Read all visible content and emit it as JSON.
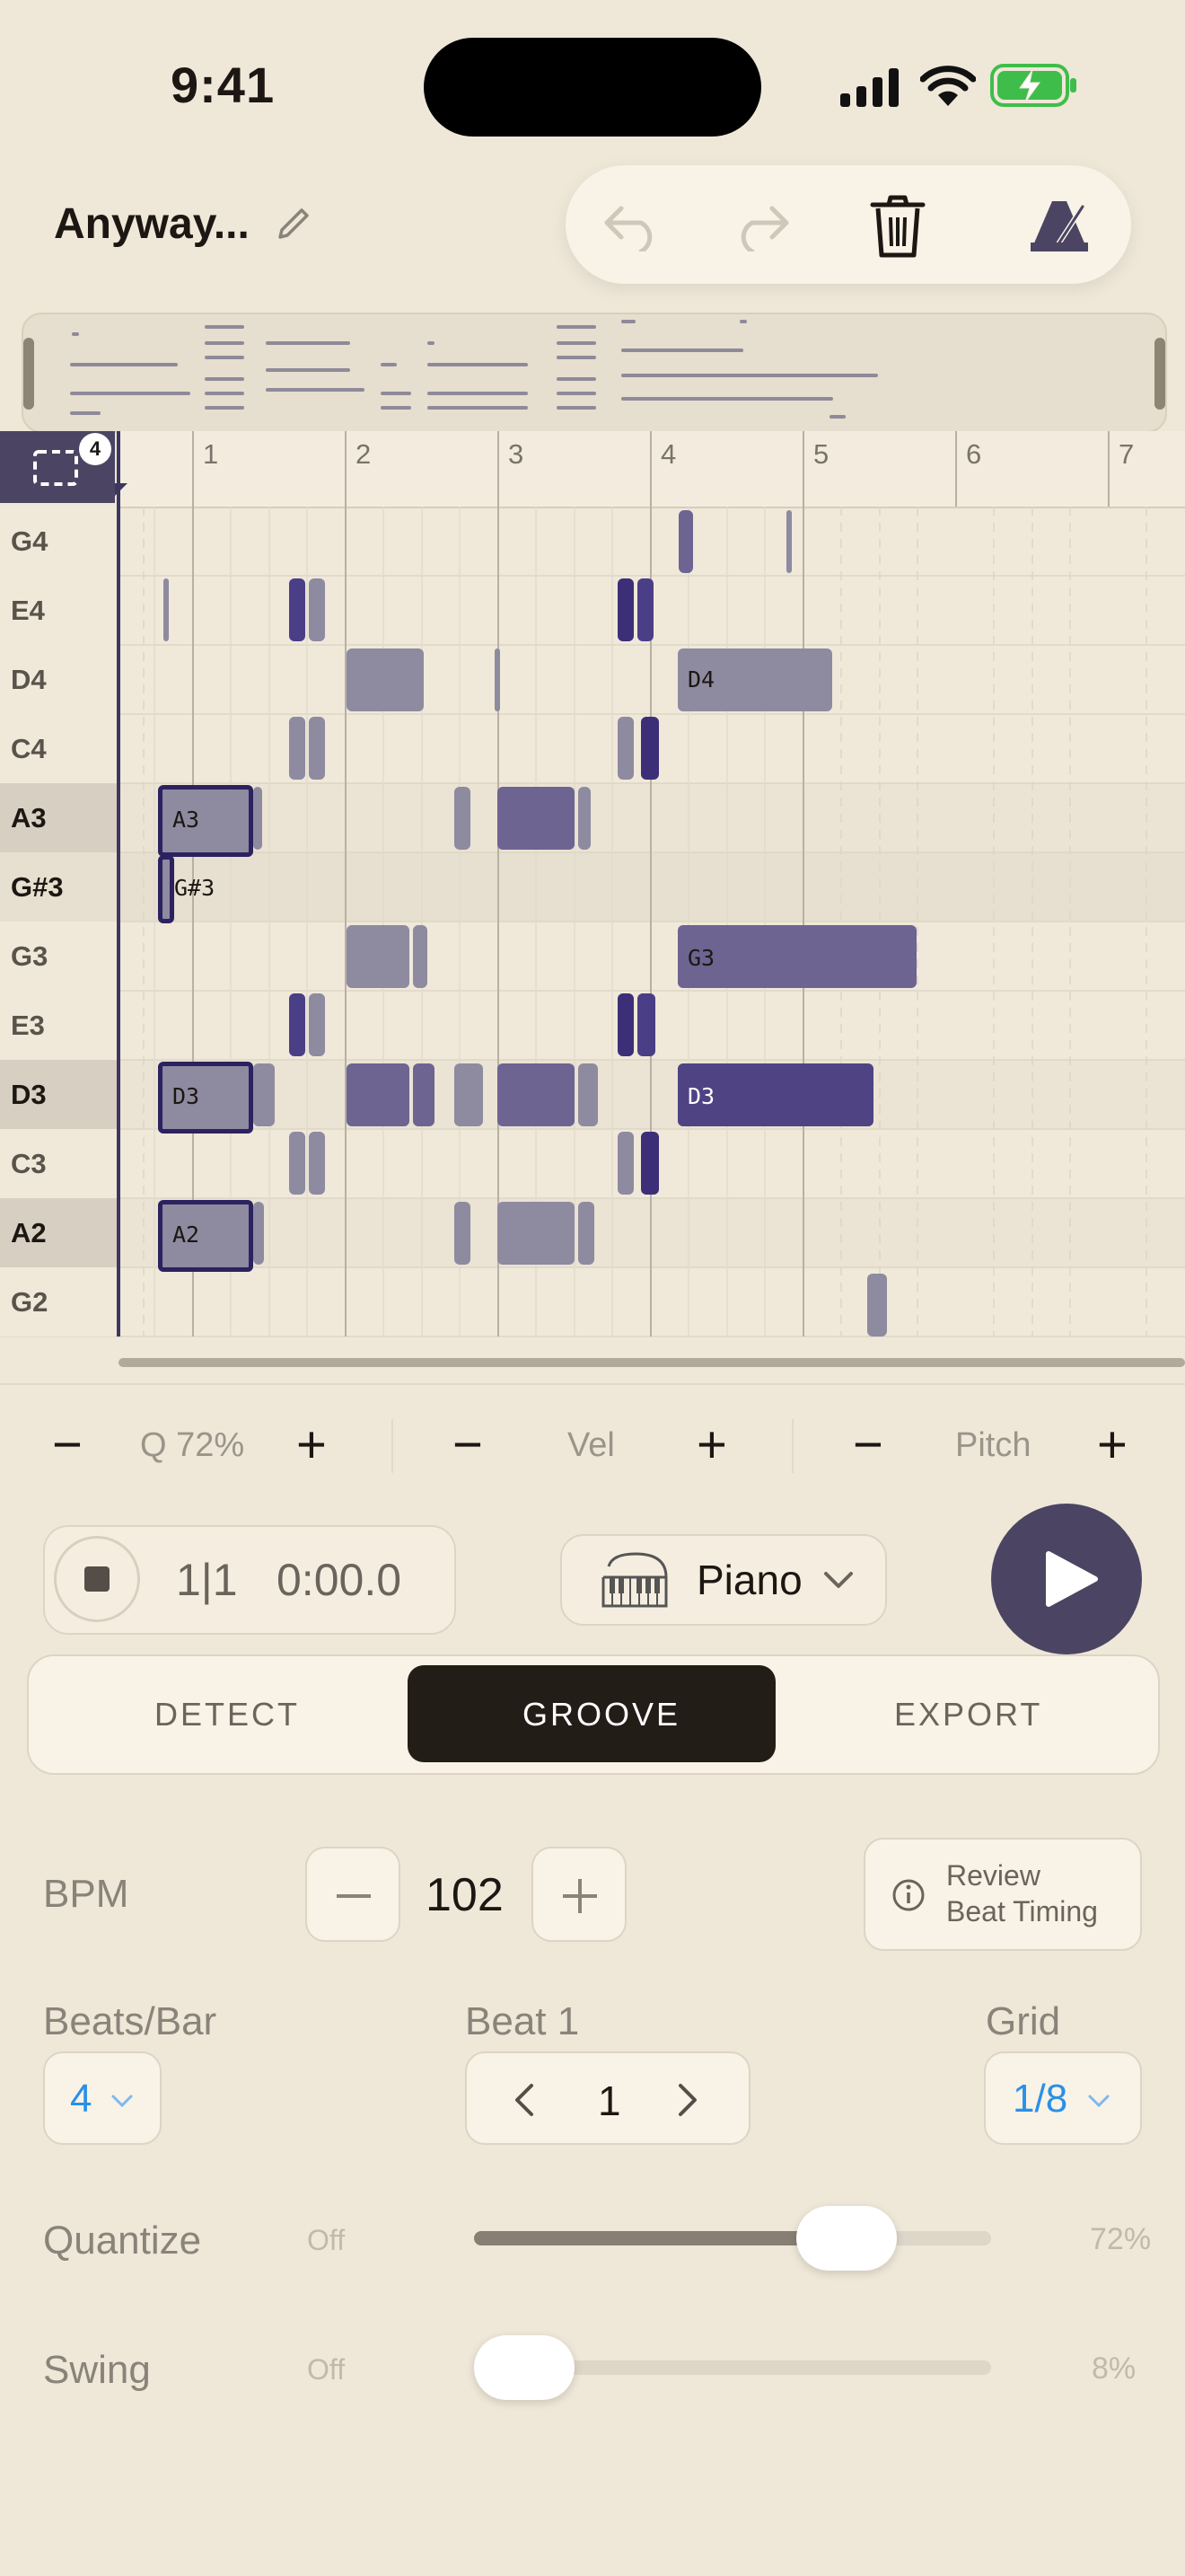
{
  "status_bar": {
    "time": "9:41"
  },
  "header": {
    "title": "Anyway..."
  },
  "toolbar": {
    "icons": [
      "undo-icon",
      "redo-icon",
      "trash-icon",
      "metronome-icon"
    ]
  },
  "piano_roll": {
    "selection_count": "4",
    "bars": [
      "1",
      "2",
      "3",
      "4",
      "5",
      "6",
      "7"
    ],
    "keys": [
      "G4",
      "E4",
      "D4",
      "C4",
      "A3",
      "G#3",
      "G3",
      "E3",
      "D3",
      "C3",
      "A2",
      "G2"
    ],
    "note_labels": {
      "a3": "A3",
      "gs3": "G#3",
      "d3": "D3",
      "a2": "A2",
      "d4": "D4",
      "g3": "G3",
      "d3_long": "D3"
    }
  },
  "nudge": {
    "minus": "−",
    "plus": "+",
    "quantize": "Q 72%",
    "velocity": "Vel",
    "pitch": "Pitch"
  },
  "transport": {
    "position": "1|1",
    "time": "0:00.0"
  },
  "instrument": {
    "name": "Piano"
  },
  "tabs": {
    "detect": "DETECT",
    "groove": "GROOVE",
    "export": "EXPORT",
    "active": "GROOVE"
  },
  "groove": {
    "bpm_label": "BPM",
    "bpm_value": "102",
    "review_line1": "Review",
    "review_line2": "Beat Timing",
    "beats_per_bar_label": "Beats/Bar",
    "beats_per_bar_value": "4",
    "beat1_label": "Beat 1",
    "beat1_value": "1",
    "grid_label": "Grid",
    "grid_value": "1/8",
    "quantize_label": "Quantize",
    "quantize_off": "Off",
    "quantize_value": "72%",
    "quantize_level": 0.72,
    "swing_label": "Swing",
    "swing_off": "Off",
    "swing_value": "8%",
    "swing_level": 0.08
  },
  "colors": {
    "background": "#efe7d8",
    "accent_blue": "#2b8fe8",
    "note_dark": "#3c2f78",
    "note_mid": "#6d6492",
    "note_grey": "#8e8aa0",
    "play_button": "#4b4563"
  }
}
